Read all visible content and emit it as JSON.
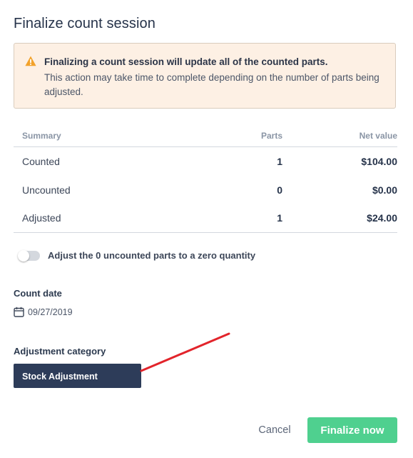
{
  "dialog": {
    "title": "Finalize count session"
  },
  "warning": {
    "icon": "warning-triangle-icon",
    "title": "Finalizing a count session will update all of the counted parts.",
    "body": "This action may take time to complete depending on the number of parts being adjusted."
  },
  "summary": {
    "headers": {
      "name": "Summary",
      "parts": "Parts",
      "value": "Net value"
    },
    "rows": [
      {
        "name": "Counted",
        "parts": "1",
        "value": "$104.00"
      },
      {
        "name": "Uncounted",
        "parts": "0",
        "value": "$0.00"
      },
      {
        "name": "Adjusted",
        "parts": "1",
        "value": "$24.00"
      }
    ]
  },
  "zero_toggle": {
    "label": "Adjust the 0 uncounted parts to a zero quantity",
    "on": false
  },
  "count_date": {
    "label": "Count date",
    "icon": "calendar-icon",
    "value": "09/27/2019"
  },
  "adjustment_category": {
    "label": "Adjustment category",
    "selected": "Stock Adjustment"
  },
  "actions": {
    "cancel": "Cancel",
    "finalize": "Finalize now"
  },
  "colors": {
    "accent": "#4fd08f",
    "select_bg": "#2d3c59",
    "warning_bg": "#fdf0e4",
    "warning_icon": "#f2a22b",
    "annotation": "#e2242b"
  }
}
